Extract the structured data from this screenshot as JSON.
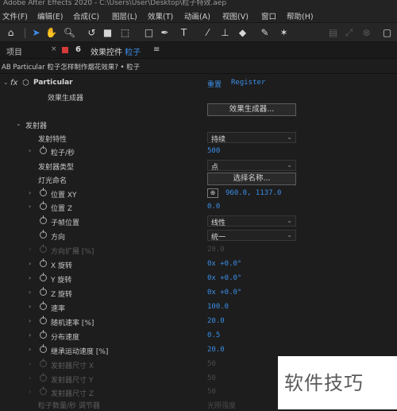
{
  "window": {
    "title": "Adobe After Effects 2020 - C:\\Users\\User\\Desktop\\粒子特效.aep"
  },
  "menu": [
    "文件(F)",
    "编辑(E)",
    "合成(C)",
    "图层(L)",
    "效果(T)",
    "动画(A)",
    "视图(V)",
    "窗口",
    "帮助(H)"
  ],
  "panel": {
    "project_tab": "项目",
    "effect_tab_prefix": "效果控件",
    "effect_tab_layer": "粒子",
    "menu_icon": "≡"
  },
  "breadcrumb": "AB Particular 粒子怎样制作烟花效果?  •  粒子",
  "effect": {
    "name": "Particular",
    "reset": "重置",
    "register": "Register",
    "builder_label": "效果生成器",
    "builder_button": "效果生成器..."
  },
  "emitter": {
    "section": "发射器",
    "rows": {
      "behavior_label": "发射特性",
      "behavior_value": "持续",
      "ppsec_label": "粒子/秒",
      "ppsec_value": "500",
      "type_label": "发射器类型",
      "type_value": "点",
      "light_label": "灯光命名",
      "light_button": "选择名称...",
      "posxy_label": "位置 XY",
      "posxy_value": "960.0, 1137.0",
      "posz_label": "位置 Z",
      "posz_value": "0.0",
      "subframe_label": "子帧位置",
      "subframe_value": "线性",
      "direction_label": "方向",
      "direction_value": "统一",
      "dirspread_label": "方向扩展 [%]",
      "dirspread_value": "20.0",
      "xrot_label": "X 旋转",
      "xrot_value": "0x +0.0°",
      "yrot_label": "Y 旋转",
      "yrot_value": "0x +0.0°",
      "zrot_label": "Z 旋转",
      "zrot_value": "0x +0.0°",
      "velocity_label": "速率",
      "velocity_value": "100.0",
      "randvel_label": "随机速率 [%]",
      "randvel_value": "20.0",
      "distvel_label": "分布速度",
      "distvel_value": "0.5",
      "inherit_label": "继承运动速度 [%]",
      "inherit_value": "20.0",
      "sizex_label": "发射器尺寸 X",
      "sizex_value": "50",
      "sizey_label": "发射器尺寸 Y",
      "sizey_value": "50",
      "sizez_label": "发射器尺寸 Z",
      "sizez_value": "50",
      "ppsec_mod_label": "粒子数量/秒 调节器",
      "ppsec_mod_value": "光照强度"
    }
  },
  "watermark": "软件技巧",
  "colors": {
    "accent": "#3b8ee6",
    "background": "#1d1d1d"
  }
}
